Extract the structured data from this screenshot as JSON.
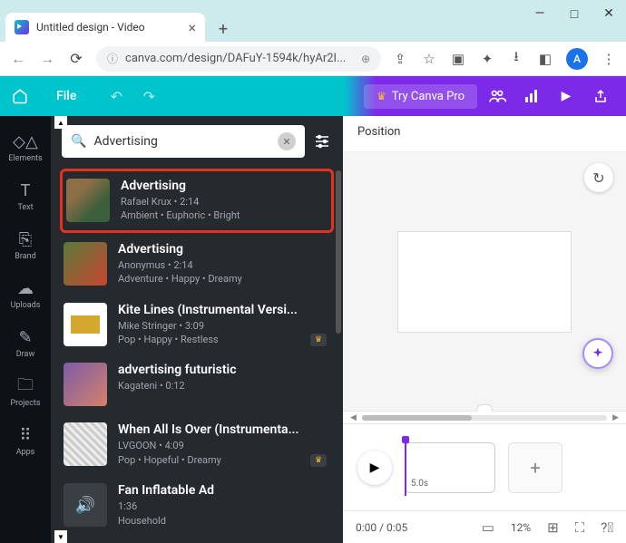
{
  "window": {
    "title": "Untitled design - Video",
    "url": "canva.com/design/DAFuY-1594k/hyAr2I...",
    "avatar_letter": "A"
  },
  "header": {
    "file_label": "File",
    "try_pro": "Try Canva Pro"
  },
  "rail": {
    "items": [
      {
        "label": "Elements"
      },
      {
        "label": "Text"
      },
      {
        "label": "Brand"
      },
      {
        "label": "Uploads"
      },
      {
        "label": "Draw"
      },
      {
        "label": "Projects"
      },
      {
        "label": "Apps"
      }
    ]
  },
  "search": {
    "value": "Advertising",
    "placeholder": "Search"
  },
  "tracks": [
    {
      "title": "Advertising",
      "artist_time": "Rafael Krux • 2:14",
      "tags": "Ambient • Euphoric • Bright",
      "pro": false,
      "highlighted": true
    },
    {
      "title": "Advertising",
      "artist_time": "Anonymus • 2:14",
      "tags": "Adventure • Happy • Dreamy",
      "pro": false,
      "highlighted": false
    },
    {
      "title": "Kite Lines (Instrumental Versi...",
      "artist_time": "Mike Stringer • 3:09",
      "tags": "Pop • Happy • Restless",
      "pro": true,
      "highlighted": false
    },
    {
      "title": "advertising futuristic",
      "artist_time": "Kagateni • 0:12",
      "tags": "",
      "pro": false,
      "highlighted": false
    },
    {
      "title": "When All Is Over (Instrumenta...",
      "artist_time": "LVGOON • 4:09",
      "tags": "Pop • Hopeful • Dreamy",
      "pro": true,
      "highlighted": false
    },
    {
      "title": "Fan Inflatable Ad",
      "artist_time": "1:36",
      "tags": "Household",
      "pro": false,
      "highlighted": false
    }
  ],
  "canvas": {
    "position_label": "Position"
  },
  "timeline": {
    "clip_duration": "5.0s",
    "time_display": "0:00 / 0:05",
    "zoom": "12%"
  }
}
